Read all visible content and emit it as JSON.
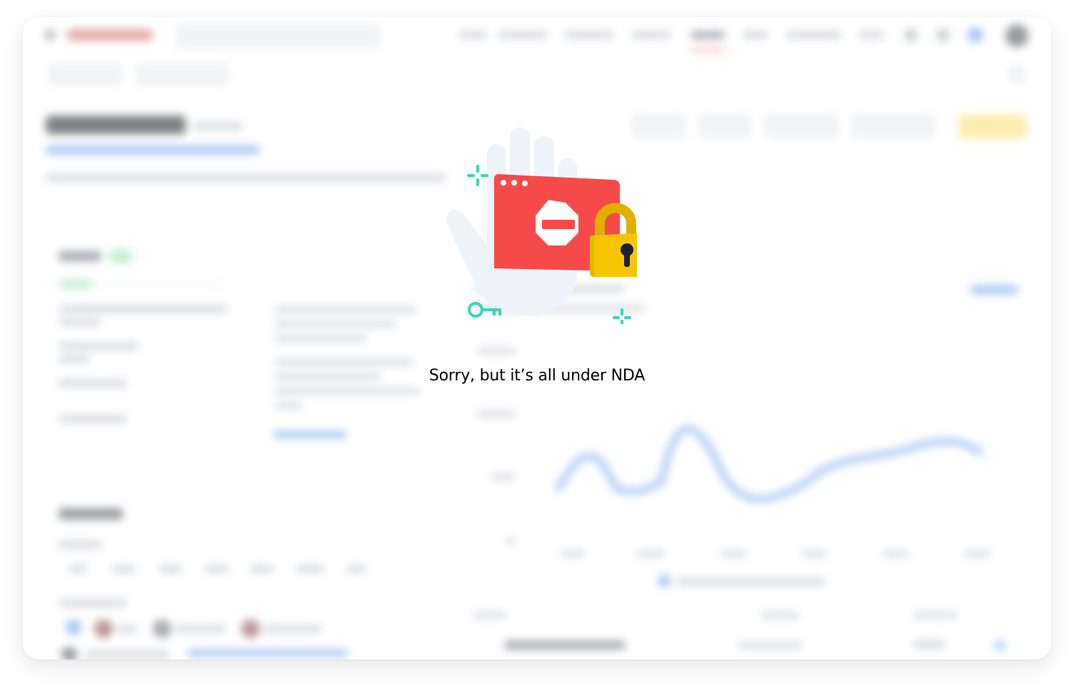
{
  "message": {
    "text": "Sorry, but it’s all under NDA"
  },
  "illustration": {
    "icons": [
      "hand-icon",
      "browser-window-icon",
      "stop-sign-icon",
      "padlock-icon",
      "key-icon",
      "sparkle-icon"
    ],
    "colors": {
      "hand": "#eef3f9",
      "window": "#f64a4a",
      "lock": "#f7c500",
      "lock_shackle": "#e0b000",
      "keyhole": "#1d1f35",
      "accent": "#3ad6b6"
    }
  },
  "background": {
    "state": "blurred",
    "accent_colors": {
      "link": "#4b8cf5",
      "success": "#38c95a",
      "warning": "#fbd54a"
    }
  }
}
